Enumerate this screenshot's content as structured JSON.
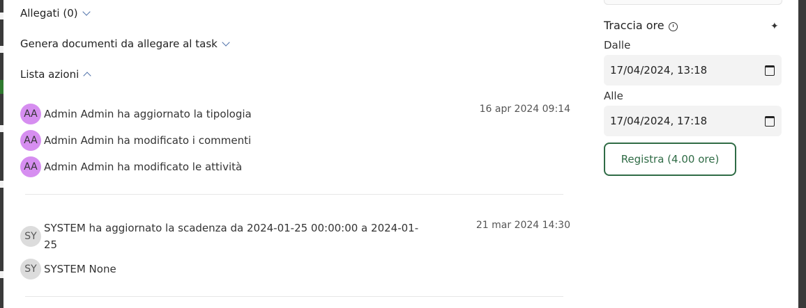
{
  "sections": {
    "attachments": "Allegati (0)",
    "generate_docs": "Genera documenti da allegare al task",
    "actions": "Lista azioni"
  },
  "action_groups": [
    {
      "timestamp": "16 apr 2024 09:14",
      "items": [
        {
          "initials": "AA",
          "text": "Admin Admin ha aggiornato la tipologia"
        },
        {
          "initials": "AA",
          "text": "Admin Admin ha modificato i commenti"
        },
        {
          "initials": "AA",
          "text": "Admin Admin ha modificato le attività"
        }
      ]
    },
    {
      "timestamp": "21 mar 2024 14:30",
      "items": [
        {
          "initials": "SY",
          "text_line1": "SYSTEM ha aggiornato la scadenza da 2024-01-25 00:00:00 a 2024-01-",
          "text_line2": "25"
        },
        {
          "initials": "SY",
          "text": "SYSTEM None"
        }
      ]
    }
  ],
  "time_tracking": {
    "title": "Traccia ore",
    "from_label": "Dalle",
    "from_value": "17/04/2024, 13:18",
    "to_label": "Alle",
    "to_value": "17/04/2024, 17:18",
    "register_label": "Registra (4.00 ore)"
  },
  "colors": {
    "admin_avatar": "#d68ef0",
    "system_avatar": "#dcdcdc",
    "accent_green": "#2f6b45"
  }
}
